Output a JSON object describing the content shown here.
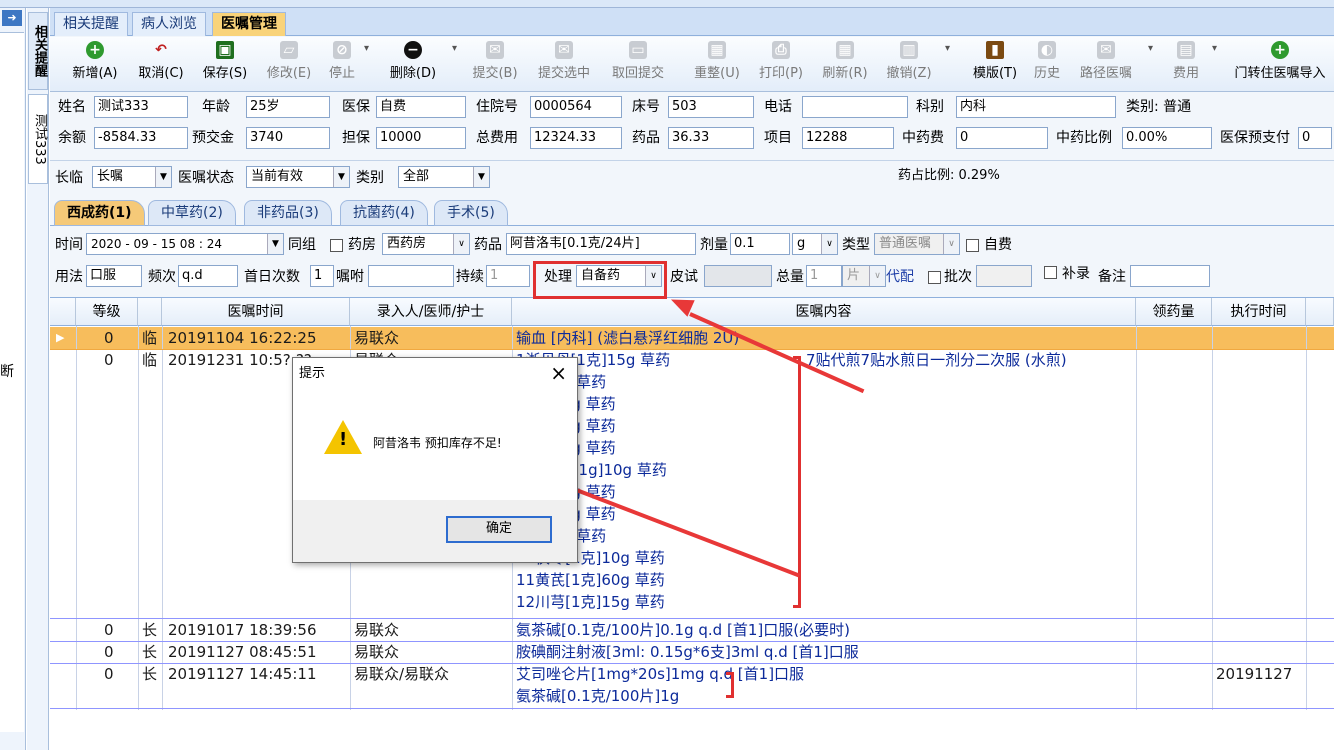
{
  "left_panel": {
    "pin": "➜",
    "cut_text": "断"
  },
  "vertical_tabs": [
    "相关提醒",
    "测试333"
  ],
  "top_tabs": [
    "相关提醒",
    "病人浏览",
    "医嘱管理"
  ],
  "toolbar": [
    {
      "label": "新增(A)",
      "icon": "plus-circle-icon"
    },
    {
      "label": "取消(C)",
      "icon": "undo-icon"
    },
    {
      "label": "保存(S)",
      "icon": "save-icon"
    },
    {
      "label": "修改(E)",
      "icon": "edit-icon"
    },
    {
      "label": "停止",
      "icon": "stop-icon"
    },
    {
      "label": "删除(D)",
      "icon": "delete-icon"
    },
    {
      "label": "提交(B)",
      "icon": "submit-icon"
    },
    {
      "label": "提交选中",
      "icon": "submit-selected-icon"
    },
    {
      "label": "取回提交",
      "icon": "retrieve-icon"
    },
    {
      "label": "重整(U)",
      "icon": "refresh-icon"
    },
    {
      "label": "打印(P)",
      "icon": "print-icon"
    },
    {
      "label": "刷新(R)",
      "icon": "reload-icon"
    },
    {
      "label": "撤销(Z)",
      "icon": "trash-icon"
    },
    {
      "label": "模版(T)",
      "icon": "template-book-icon"
    },
    {
      "label": "历史",
      "icon": "history-icon"
    },
    {
      "label": "路径医嘱",
      "icon": "path-icon"
    },
    {
      "label": "费用",
      "icon": "fee-icon"
    },
    {
      "label": "门转住医嘱导入",
      "icon": "import-icon"
    }
  ],
  "patient": {
    "name_label": "姓名",
    "name": "测试333",
    "age_label": "年龄",
    "age": "25岁",
    "insurance_label": "医保",
    "insurance": "自费",
    "admission_label": "住院号",
    "admission": "0000564",
    "bed_label": "床号",
    "bed": "503",
    "phone_label": "电话",
    "phone": "",
    "dept_label": "科别",
    "dept": "内科",
    "category": "类别: 普通",
    "balance_label": "余额",
    "balance": "-8584.33",
    "prepay_label": "预交金",
    "prepay": "3740",
    "guarantee_label": "担保",
    "guarantee": "10000",
    "total_label": "总费用",
    "total": "12324.33",
    "drug_label": "药品",
    "drug": "36.33",
    "item_label": "项目",
    "item": "12288",
    "herb_label": "中药费",
    "herb": "0",
    "herb_ratio_label": "中药比例",
    "herb_ratio": "0.00%",
    "ins_prepay_label": "医保预支付",
    "ins_prepay": "0"
  },
  "filters": {
    "type_label": "长临",
    "type": "长嘱",
    "status_label": "医嘱状态",
    "status": "当前有效",
    "class_label": "类别",
    "class": "全部",
    "drug_ratio": "药占比例: 0.29%"
  },
  "drug_tabs": [
    "西成药(1)",
    "中草药(2)",
    "非药品(3)",
    "抗菌药(4)",
    "手术(5)"
  ],
  "entry": {
    "time_label": "时间",
    "time": "2020 - 09 - 15   08 : 24",
    "group_label": "同组",
    "pharmacy_label": "药房",
    "pharmacy": "西药房",
    "drug_label": "药品",
    "drug": "阿昔洛韦[0.1克/24片]",
    "dose_label": "剂量",
    "dose": "0.1",
    "unit": "g",
    "order_type_label": "类型",
    "order_type": "普通医嘱",
    "selfpay_label": "自费",
    "usage_label": "用法",
    "usage": "口服",
    "freq_label": "频次",
    "freq": "q.d",
    "first_count_label": "首日次数",
    "first_count": "1",
    "instr_label": "嘱咐",
    "duration_label": "持续",
    "duration": "1",
    "handle_label": "处理",
    "handle": "自备药",
    "skin_label": "皮试",
    "total_label": "总量",
    "total": "1",
    "total_unit": "片",
    "substitute_label": "代配",
    "batch_label": "批次",
    "supplement_label": "补录",
    "remark_label": "备注"
  },
  "grid": {
    "headers": [
      "等级",
      "医嘱时间",
      "录入人/医师/护士",
      "医嘱内容",
      "领药量",
      "执行时间"
    ],
    "rows": [
      {
        "level": "0",
        "kind": "临",
        "time": "20191104 16:22:25",
        "person": "易联众",
        "content": [
          "输血      [内科] (滤白悬浮红细胞 2U)"
        ],
        "exec": "",
        "selected": true
      },
      {
        "level": "0",
        "kind": "临",
        "time": "20191231 10:5?:??",
        "person": "易联众",
        "content": [
          "1浙贝母[1克]15g 草药",
          "[1克]6g 草药",
          "[1克]10g 草药",
          "[1克]10g 草药",
          "[1克]30g 草药",
          "(胆南星)[1g]10g 草药",
          "[1克]10g 草药",
          "[1克]15g 草药",
          "[1克]6g 草药",
          "10茯苓[1克]10g 草药",
          "11黄芪[1克]60g 草药",
          "12川芎[1克]15g 草药"
        ],
        "note": "7贴代煎7贴水煎日一剂分二次服 (水煎)",
        "exec": ""
      },
      {
        "level": "0",
        "kind": "长",
        "time": "20191017 18:39:56",
        "person": "易联众",
        "content": [
          "氨茶碱[0.1克/100片]0.1g q.d [首1]口服(必要时)"
        ],
        "exec": ""
      },
      {
        "level": "0",
        "kind": "长",
        "time": "20191127 08:45:51",
        "person": "易联众",
        "content": [
          "胺碘酮注射液[3ml: 0.15g*6支]3ml q.d [首1]口服"
        ],
        "exec": ""
      },
      {
        "level": "0",
        "kind": "长",
        "time": "20191127 14:45:11",
        "person": "易联众/易联众",
        "content": [
          "艾司唑仑片[1mg*20s]1mg q.d [首1]口服",
          "氨茶碱[0.1克/100片]1g"
        ],
        "exec": "20191127"
      }
    ]
  },
  "dialog": {
    "title": "提示",
    "message": "阿昔洛韦 预扣库存不足!",
    "ok": "确定",
    "close": "×",
    "icon_glyph": "!"
  },
  "colors": {
    "selected_row": "#f7bd5c",
    "warning": "#f4c400",
    "annotation": "#e03030",
    "content_text": "#0c2a9a"
  }
}
